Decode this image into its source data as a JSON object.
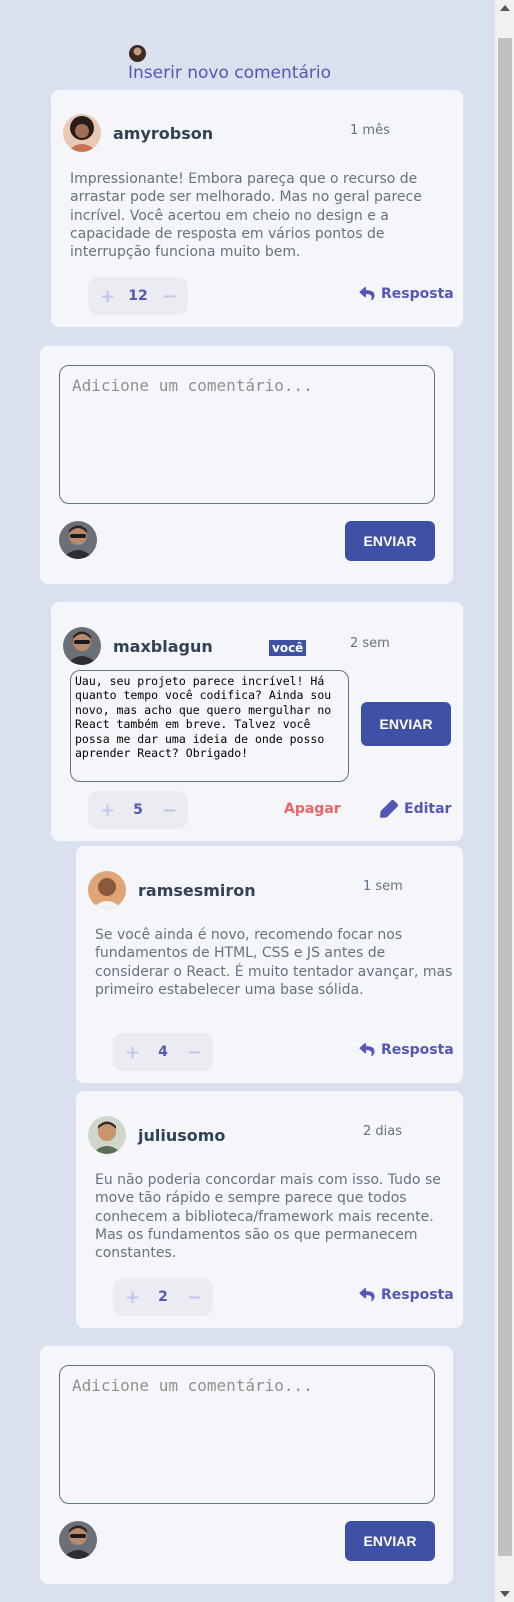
{
  "header": {
    "link_text": "Inserir novo comentário"
  },
  "comments": [
    {
      "username": "amyrobson",
      "date": "1 mês",
      "content": "Impressionante! Embora pareça que o recurso de arrastar pode ser melhorado. Mas no geral parece incrível. Você acertou em cheio no design e a capacidade de resposta em vários pontos de interrupção funciona muito bem.",
      "score": "12",
      "reply_label": "Resposta"
    },
    {
      "username": "maxblagun",
      "badge": "você",
      "date": "2 sem",
      "content": "Uau, seu projeto parece incrível! Há quanto tempo você codifica? Ainda sou novo, mas acho que quero mergulhar no React também em breve. Talvez você possa me dar uma ideia de onde posso aprender React? Obrigado!",
      "score": "5",
      "delete_label": "Apagar",
      "edit_label": "Editar",
      "send_label": "ENVIAR"
    }
  ],
  "replies": [
    {
      "username": "ramsesmiron",
      "date": "1 sem",
      "content": "Se você ainda é novo, recomendo focar nos fundamentos de HTML, CSS e JS antes de considerar o React. É muito tentador avançar, mas primeiro estabelecer uma base sólida.",
      "score": "4",
      "reply_label": "Resposta"
    },
    {
      "username": "juliusomo",
      "date": "2 dias",
      "content": "Eu não poderia concordar mais com isso. Tudo se move tão rápido e sempre parece que todos conhecem a biblioteca/framework mais recente. Mas os fundamentos são os que permanecem constantes.",
      "score": "2",
      "reply_label": "Resposta"
    }
  ],
  "form": {
    "placeholder": "Adicione um comentário...",
    "send_label": "ENVIAR"
  },
  "colors": {
    "background": "#dbe0ef",
    "card": "#f5f6fa",
    "primary": "#5457b6",
    "button": "#3f51a6",
    "delete": "#ed6468"
  }
}
